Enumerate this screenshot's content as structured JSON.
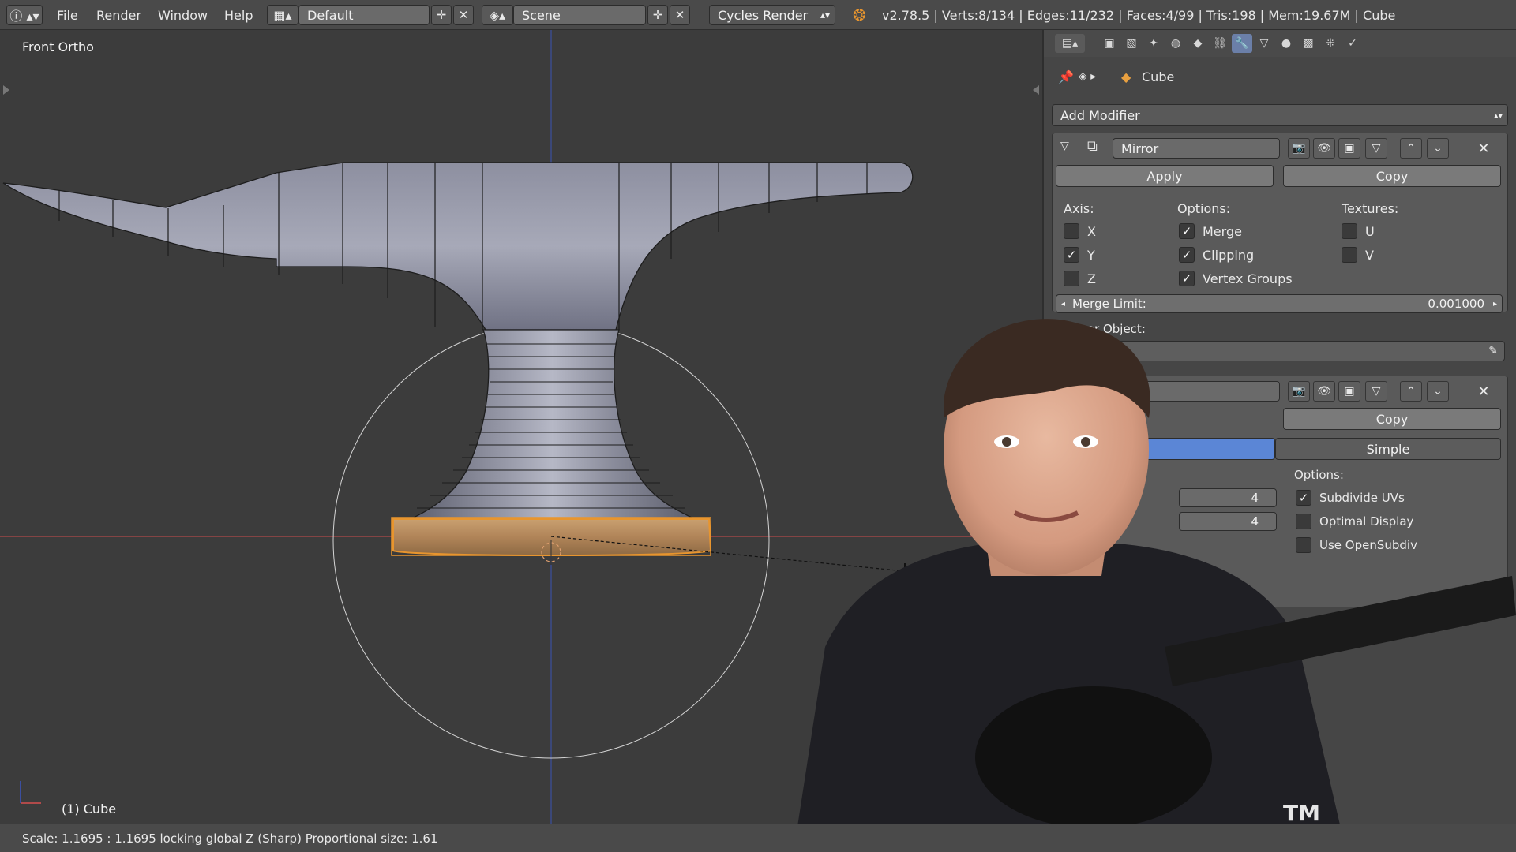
{
  "header": {
    "info_icon": "info-icon",
    "menus": [
      "File",
      "Render",
      "Window",
      "Help"
    ],
    "layout_name": "Default",
    "scene_name": "Scene",
    "render_engine": "Cycles Render",
    "stats": "v2.78.5 | Verts:8/134 | Edges:11/232 | Faces:4/99 | Tris:198 | Mem:19.67M | Cube"
  },
  "viewport": {
    "view_name": "Front Ortho",
    "object_label": "(1) Cube"
  },
  "status": {
    "text": "Scale: 1.1695 : 1.1695 locking global Z (Sharp) Proportional size: 1.61"
  },
  "properties": {
    "context_object": "Cube",
    "add_modifier_label": "Add Modifier",
    "mirror": {
      "name": "Mirror",
      "apply_label": "Apply",
      "copy_label": "Copy",
      "axis_label": "Axis:",
      "options_label": "Options:",
      "textures_label": "Textures:",
      "axes": [
        {
          "label": "X",
          "checked": false
        },
        {
          "label": "Y",
          "checked": true
        },
        {
          "label": "Z",
          "checked": false
        }
      ],
      "options": [
        {
          "label": "Merge",
          "checked": true
        },
        {
          "label": "Clipping",
          "checked": true
        },
        {
          "label": "Vertex Groups",
          "checked": true
        }
      ],
      "textures": [
        {
          "label": "U",
          "checked": false
        },
        {
          "label": "V",
          "checked": false
        }
      ],
      "merge_limit_label": "Merge Limit:",
      "merge_limit_value": "0.001000",
      "mirror_object_label": "Mirror Object:"
    },
    "subsurf": {
      "copy_label": "Copy",
      "mode_simple": "Simple",
      "options_label": "Options:",
      "view_value": "4",
      "render_value": "4",
      "options": [
        {
          "label": "Subdivide UVs",
          "checked": true
        },
        {
          "label": "Optimal Display",
          "checked": false
        },
        {
          "label": "Use OpenSubdiv",
          "checked": false
        }
      ]
    }
  },
  "colors": {
    "selection_orange": "#e8952e",
    "active_tab_blue": "#6b7fa8",
    "x_axis_red": "#b04a4a",
    "z_axis_blue": "#3b4fa0"
  }
}
